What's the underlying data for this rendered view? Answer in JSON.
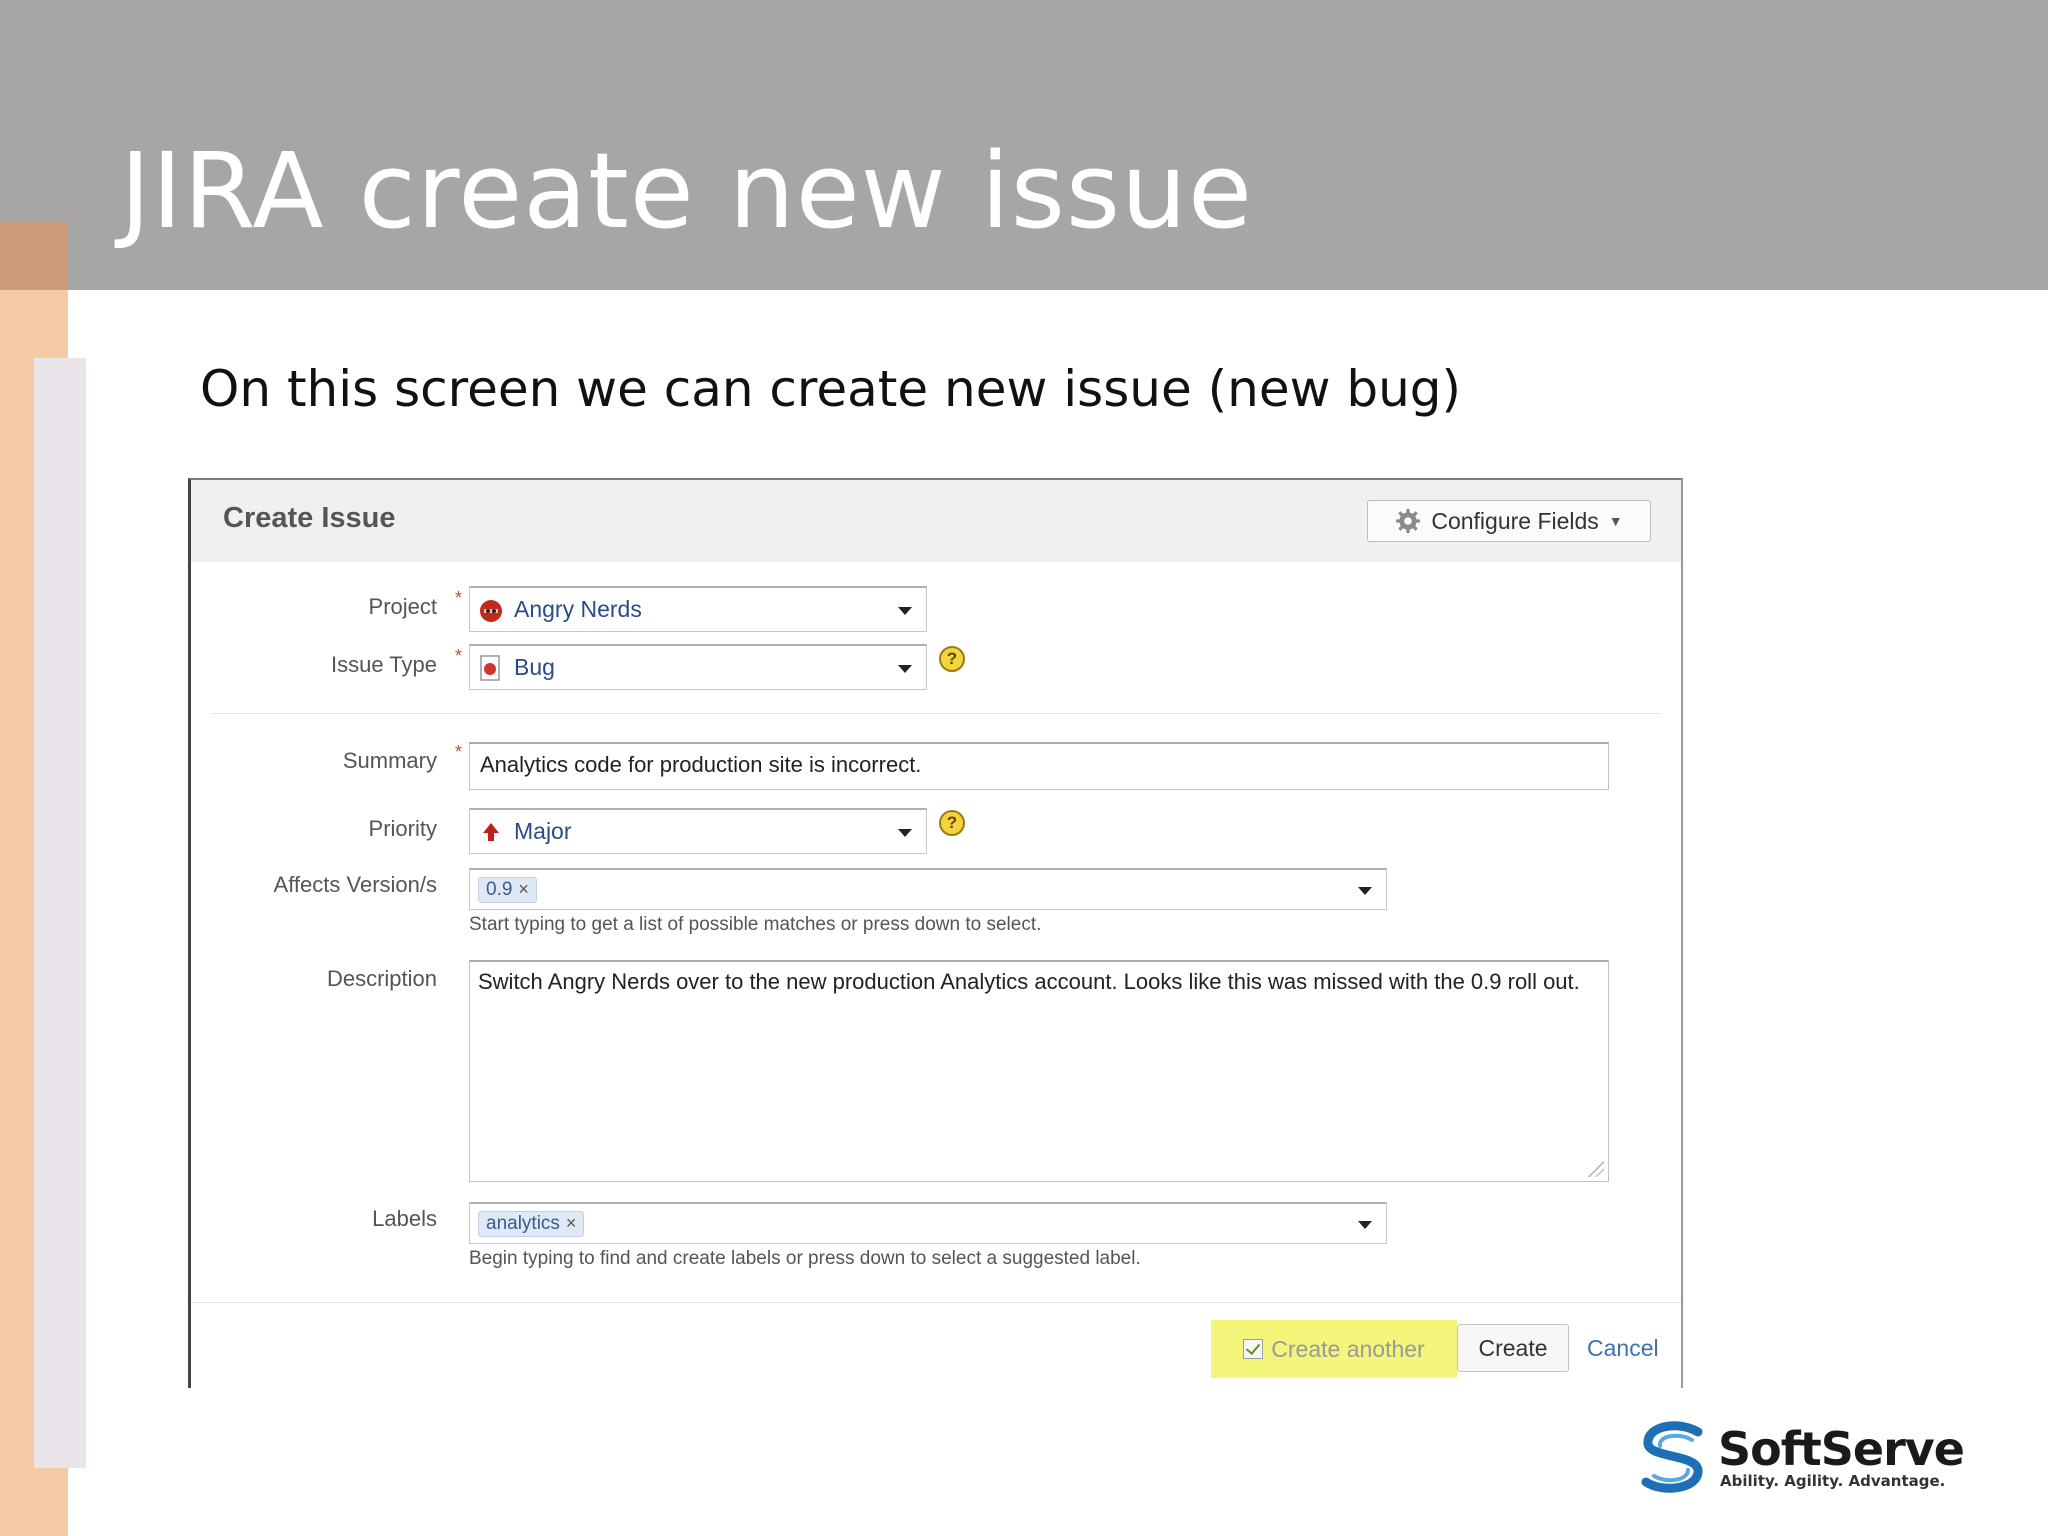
{
  "slide": {
    "title": "JIRA create new issue",
    "subtitle": "On this screen we can create new issue (new bug)"
  },
  "dialog": {
    "title": "Create Issue",
    "configure_fields_label": "Configure Fields",
    "fields": {
      "project": {
        "label": "Project",
        "required_mark": "*",
        "value": "Angry Nerds",
        "icon": "angry-nerds-project-icon"
      },
      "issue_type": {
        "label": "Issue Type",
        "required_mark": "*",
        "value": "Bug",
        "icon": "bug-icon",
        "help": "?"
      },
      "summary": {
        "label": "Summary",
        "required_mark": "*",
        "value": "Analytics code for production site is incorrect."
      },
      "priority": {
        "label": "Priority",
        "value": "Major",
        "icon": "major-priority-arrow-icon",
        "help": "?"
      },
      "affects_versions": {
        "label": "Affects Version/s",
        "tags": [
          "0.9"
        ],
        "hint": "Start typing to get a list of possible matches or press down to select."
      },
      "description": {
        "label": "Description",
        "value": "Switch Angry Nerds over to the new production Analytics account. Looks like this was missed with the 0.9 roll out."
      },
      "labels": {
        "label": "Labels",
        "tags": [
          "analytics"
        ],
        "hint": "Begin typing to find and create labels or press down to select a suggested label."
      }
    },
    "footer": {
      "create_another_label": "Create another",
      "create_another_checked": true,
      "create_label": "Create",
      "cancel_label": "Cancel"
    }
  },
  "logo": {
    "name": "SoftServe",
    "tagline": "Ability. Agility. Advantage."
  },
  "colors": {
    "header_band": "#a6a6a6",
    "side_accent": "#f5cba6",
    "highlight": "#f3f67a",
    "link": "#3b73af",
    "required": "#d04437"
  }
}
